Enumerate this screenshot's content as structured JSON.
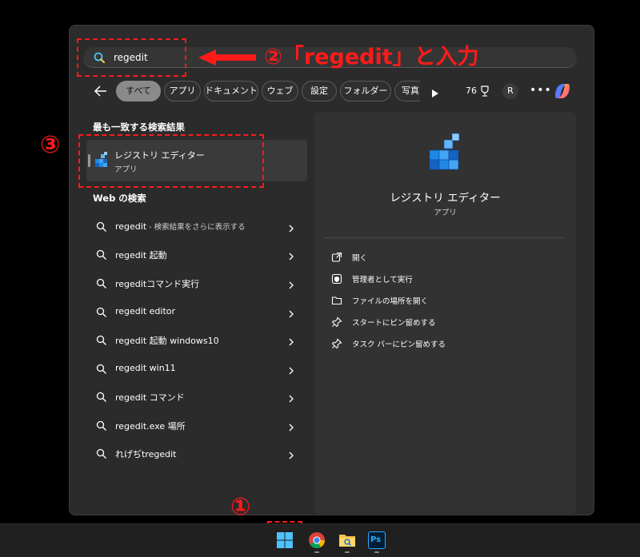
{
  "search": {
    "value": "regedit"
  },
  "filters": {
    "chips": [
      "すべて",
      "アプリ",
      "ドキュメント",
      "ウェブ",
      "設定",
      "フォルダー",
      "写真"
    ],
    "points": "76",
    "avatar_letter": "R"
  },
  "best_match": {
    "heading": "最も一致する検索結果",
    "name": "レジストリ エディター",
    "type": "アプリ"
  },
  "web_search": {
    "heading": "Web の検索",
    "items": [
      {
        "text": "regedit",
        "suffix": " - 検索結果をさらに表示する"
      },
      {
        "text": "regedit 起動",
        "suffix": ""
      },
      {
        "text": "regeditコマンド実行",
        "suffix": ""
      },
      {
        "text": "regedit editor",
        "suffix": ""
      },
      {
        "text": "regedit 起動 windows10",
        "suffix": ""
      },
      {
        "text": "regedit win11",
        "suffix": ""
      },
      {
        "text": "regedit コマンド",
        "suffix": ""
      },
      {
        "text": "regedit.exe 場所",
        "suffix": ""
      },
      {
        "text": "れげぢtregedit",
        "suffix": ""
      }
    ]
  },
  "detail": {
    "name": "レジストリ エディター",
    "type": "アプリ",
    "actions": [
      {
        "icon": "open-icon",
        "label": "開く"
      },
      {
        "icon": "shield-icon",
        "label": "管理者として実行"
      },
      {
        "icon": "folder-icon",
        "label": "ファイルの場所を開く"
      },
      {
        "icon": "pin-icon",
        "label": "スタートにピン留めする"
      },
      {
        "icon": "pin-icon",
        "label": "タスク バーにピン留めする"
      }
    ]
  },
  "annotations": {
    "step1": "①",
    "step2": "②「regedit」と入力",
    "step3": "③",
    "color": "#ff1a1a"
  },
  "taskbar": {
    "icons": [
      "windows-start-icon",
      "chrome-icon",
      "file-explorer-icon",
      "photoshop-icon"
    ],
    "ps_label": "Ps"
  }
}
